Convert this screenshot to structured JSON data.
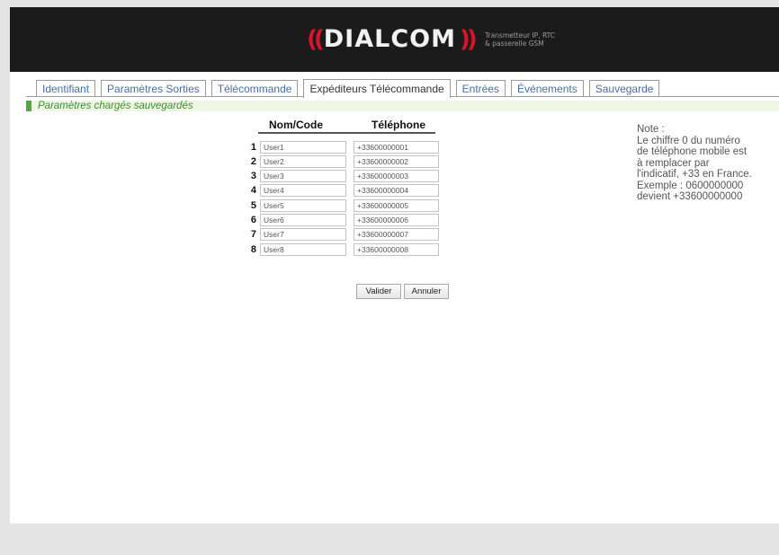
{
  "header": {
    "brand": "DIALCOM",
    "tagline_line1": "Transmetteur  IP, RTC",
    "tagline_line2": "& passerelle     GSM"
  },
  "tabs": [
    {
      "label": "Identifiant",
      "active": false
    },
    {
      "label": "Paramètres Sorties",
      "active": false
    },
    {
      "label": "Télécommande",
      "active": false
    },
    {
      "label": "Expéditeurs Télécommande",
      "active": true
    },
    {
      "label": "Entrées",
      "active": false
    },
    {
      "label": "Événements",
      "active": false
    },
    {
      "label": "Sauvegarde",
      "active": false
    }
  ],
  "status": {
    "message": "Paramètres chargés sauvegardés"
  },
  "table": {
    "col_name": "Nom/Code",
    "col_phone": "Téléphone",
    "rows": [
      {
        "num": "1",
        "name": "User1",
        "phone": "+33600000001"
      },
      {
        "num": "2",
        "name": "User2",
        "phone": "+33600000002"
      },
      {
        "num": "3",
        "name": "User3",
        "phone": "+33600000003"
      },
      {
        "num": "4",
        "name": "User4",
        "phone": "+33600000004"
      },
      {
        "num": "5",
        "name": "User5",
        "phone": "+33600000005"
      },
      {
        "num": "6",
        "name": "User6",
        "phone": "+33600000006"
      },
      {
        "num": "7",
        "name": "User7",
        "phone": "+33600000007"
      },
      {
        "num": "8",
        "name": "User8",
        "phone": "+33600000008"
      }
    ]
  },
  "buttons": {
    "validate": "Valider",
    "cancel": "Annuler"
  },
  "note": {
    "lines": [
      "Note :",
      "Le chiffre 0 du numéro",
      "de téléphone mobile est",
      "à remplacer par",
      "l'indicatif, +33 en France.",
      "Exemple : 0600000000",
      "devient +33600000000"
    ]
  },
  "colors": {
    "header_bg": "#1b1b1b",
    "brand_red": "#d4162b",
    "tab_link": "#4a6ea5",
    "status_green": "#5ba246",
    "status_bg": "#eef6e6"
  }
}
